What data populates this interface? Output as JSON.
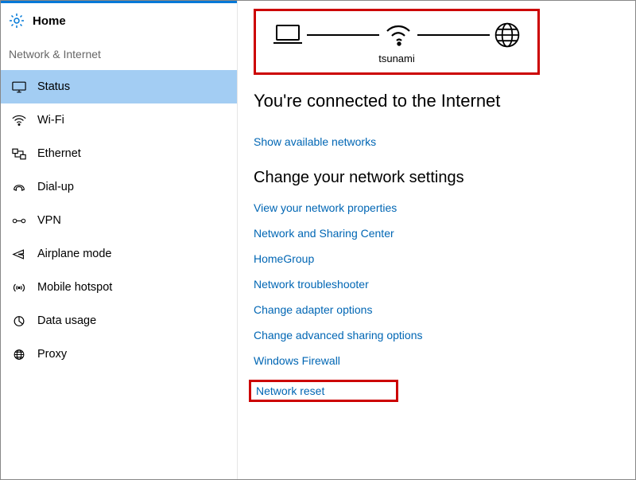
{
  "sidebar": {
    "home_label": "Home",
    "section_label": "Network & Internet",
    "items": [
      {
        "label": "Status"
      },
      {
        "label": "Wi-Fi"
      },
      {
        "label": "Ethernet"
      },
      {
        "label": "Dial-up"
      },
      {
        "label": "VPN"
      },
      {
        "label": "Airplane mode"
      },
      {
        "label": "Mobile hotspot"
      },
      {
        "label": "Data usage"
      },
      {
        "label": "Proxy"
      }
    ]
  },
  "main": {
    "network_name": "tsunami",
    "status_heading": "You're connected to the Internet",
    "show_networks": "Show available networks",
    "change_heading": "Change your network settings",
    "links": [
      "View your network properties",
      "Network and Sharing Center",
      "HomeGroup",
      "Network troubleshooter",
      "Change adapter options",
      "Change advanced sharing options",
      "Windows Firewall",
      "Network reset"
    ]
  }
}
